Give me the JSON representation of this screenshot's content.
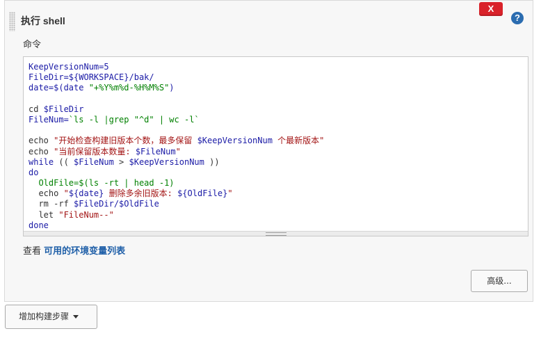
{
  "step": {
    "title": "执行 shell",
    "close_label": "X",
    "help_label": "?",
    "command_label": "命令"
  },
  "editor": {
    "lines": [
      [
        {
          "t": "KeepVersionNum=5",
          "c": "kw"
        }
      ],
      [
        {
          "t": "FileDir=${WORKSPACE}/bak/",
          "c": "kw"
        }
      ],
      [
        {
          "t": "date=$(date ",
          "c": "kw"
        },
        {
          "t": "\"+%Y%m%d-%H%M%S\"",
          "c": "grn"
        },
        {
          "t": ")",
          "c": "kw"
        }
      ],
      [],
      [
        {
          "t": "cd ",
          "c": "cmd"
        },
        {
          "t": "$FileDir",
          "c": "var"
        }
      ],
      [
        {
          "t": "FileNum=",
          "c": "kw"
        },
        {
          "t": "`ls -l |grep \"^d\" | wc -l`",
          "c": "grn"
        }
      ],
      [],
      [
        {
          "t": "echo ",
          "c": "cmd"
        },
        {
          "t": "\"开始检查构建旧版本个数，最多保留 ",
          "c": "str"
        },
        {
          "t": "$KeepVersionNum",
          "c": "strv"
        },
        {
          "t": " 个最新版本\"",
          "c": "str"
        }
      ],
      [
        {
          "t": "echo ",
          "c": "cmd"
        },
        {
          "t": "\"当前保留版本数量: ",
          "c": "str"
        },
        {
          "t": "$FileNum",
          "c": "strv"
        },
        {
          "t": "\"",
          "c": "str"
        }
      ],
      [
        {
          "t": "while",
          "c": "kw"
        },
        {
          "t": " (( ",
          "c": "cmd"
        },
        {
          "t": "$FileNum",
          "c": "var"
        },
        {
          "t": " > ",
          "c": "cmd"
        },
        {
          "t": "$KeepVersionNum",
          "c": "var"
        },
        {
          "t": " ))",
          "c": "cmd"
        }
      ],
      [
        {
          "t": "do",
          "c": "kw"
        }
      ],
      [
        {
          "t": "  OldFile=$(ls -rt | head -1)",
          "c": "grn"
        }
      ],
      [
        {
          "t": "  echo ",
          "c": "cmd"
        },
        {
          "t": "\"",
          "c": "str"
        },
        {
          "t": "${date}",
          "c": "strv"
        },
        {
          "t": " 删除多余旧版本: ",
          "c": "str"
        },
        {
          "t": "${OldFile}",
          "c": "strv"
        },
        {
          "t": "\"",
          "c": "str"
        }
      ],
      [
        {
          "t": "  rm -rf ",
          "c": "cmd"
        },
        {
          "t": "$FileDir/$OldFile",
          "c": "var"
        }
      ],
      [
        {
          "t": "  let ",
          "c": "cmd"
        },
        {
          "t": "\"FileNum--\"",
          "c": "str"
        }
      ],
      [
        {
          "t": "done",
          "c": "kw"
        }
      ]
    ]
  },
  "env": {
    "prefix": "查看",
    "link_label": "可用的环境变量列表"
  },
  "buttons": {
    "advanced_label": "高级...",
    "add_step_label": "增加构建步骤"
  }
}
